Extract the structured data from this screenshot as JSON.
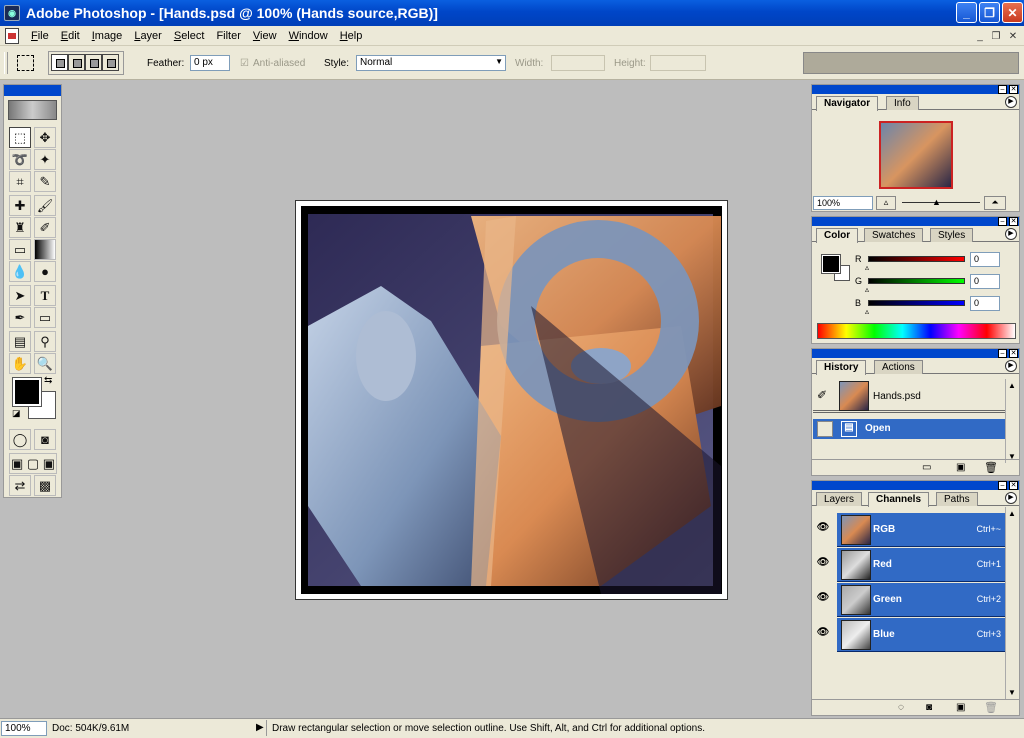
{
  "window": {
    "title": "Adobe Photoshop - [Hands.psd @ 100% (Hands source,RGB)]",
    "minimize_glyph": "_",
    "maximize_glyph": "❐",
    "close_glyph": "✕"
  },
  "menu": {
    "items": [
      {
        "label": "File",
        "accel": "F",
        "rest": "ile"
      },
      {
        "label": "Edit",
        "accel": "E",
        "rest": "dit"
      },
      {
        "label": "Image",
        "accel": "I",
        "rest": "mage"
      },
      {
        "label": "Layer",
        "accel": "L",
        "rest": "ayer"
      },
      {
        "label": "Select",
        "accel": "S",
        "rest": "elect"
      },
      {
        "label": "Filter",
        "accel": "F",
        "rest": "ilter"
      },
      {
        "label": "View",
        "accel": "V",
        "rest": "iew"
      },
      {
        "label": "Window",
        "accel": "W",
        "rest": "indow"
      },
      {
        "label": "Help",
        "accel": "H",
        "rest": "elp"
      }
    ]
  },
  "options": {
    "feather_label": "Feather:",
    "feather_value": "0 px",
    "antialiased_label": "Anti-aliased",
    "style_label": "Style:",
    "style_value": "Normal",
    "width_label": "Width:",
    "height_label": "Height:"
  },
  "navigator": {
    "tabs": [
      "Navigator",
      "Info"
    ],
    "zoom": "100%"
  },
  "color": {
    "tabs": [
      "Color",
      "Swatches",
      "Styles"
    ],
    "r_label": "R",
    "g_label": "G",
    "b_label": "B",
    "r_value": "0",
    "g_value": "0",
    "b_value": "0",
    "foreground": "#000000",
    "background": "#ffffff"
  },
  "history": {
    "tabs": [
      "History",
      "Actions"
    ],
    "snapshot": "Hands.psd",
    "states": [
      "Open"
    ]
  },
  "channels": {
    "tabs": [
      "Layers",
      "Channels",
      "Paths"
    ],
    "rows": [
      {
        "name": "RGB",
        "shortcut": "Ctrl+~"
      },
      {
        "name": "Red",
        "shortcut": "Ctrl+1"
      },
      {
        "name": "Green",
        "shortcut": "Ctrl+2"
      },
      {
        "name": "Blue",
        "shortcut": "Ctrl+3"
      }
    ]
  },
  "status": {
    "zoom": "100%",
    "doc": "Doc: 504K/9.61M",
    "hint": "Draw rectangular selection or move selection outline.  Use Shift, Alt, and Ctrl for additional options."
  },
  "colors": {
    "titlebar": "#0046c8",
    "selection": "#316ac5",
    "chrome": "#ece9d8",
    "workspace": "#bdbdbd"
  }
}
